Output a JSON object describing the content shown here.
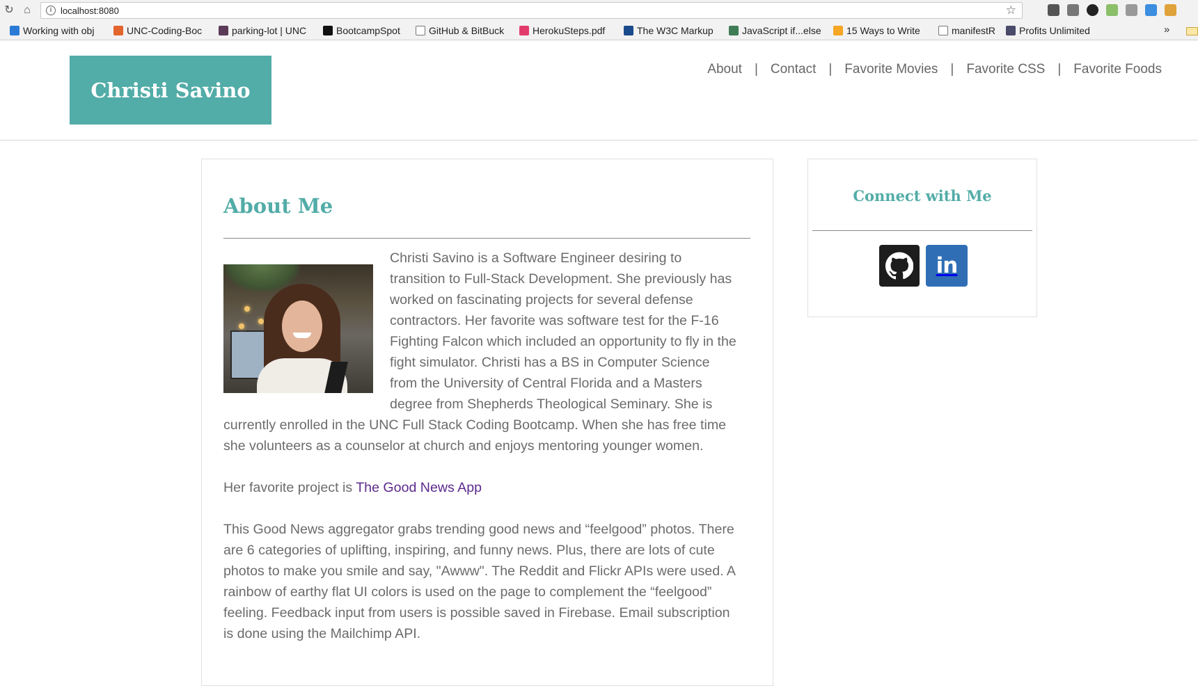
{
  "browser": {
    "url": "localhost:8080",
    "bookmarks": [
      {
        "label": "Working with obj",
        "color": "#2a7bd6"
      },
      {
        "label": "UNC-Coding-Boc",
        "color": "#e2652d"
      },
      {
        "label": "parking-lot | UNC",
        "color": "#5b3a58"
      },
      {
        "label": "BootcampSpot",
        "color": "#111111"
      },
      {
        "label": "GitHub & BitBuck",
        "color": "#ffffff"
      },
      {
        "label": "HerokuSteps.pdf",
        "color": "#e23b6b"
      },
      {
        "label": "The W3C Markup",
        "color": "#1a4b8c"
      },
      {
        "label": "JavaScript if...else",
        "color": "#3f7d57"
      },
      {
        "label": "15 Ways to Write",
        "color": "#f5a623"
      },
      {
        "label": "manifestR",
        "color": "#ffffff"
      },
      {
        "label": "Profits Unlimited",
        "color": "#4a4a6a"
      }
    ],
    "more_label": "»"
  },
  "header": {
    "brand": "Christi Savino",
    "nav": [
      {
        "label": "About"
      },
      {
        "label": "Contact"
      },
      {
        "label": "Favorite Movies"
      },
      {
        "label": "Favorite CSS"
      },
      {
        "label": "Favorite Foods"
      }
    ],
    "separator": "|"
  },
  "about": {
    "title": "About Me",
    "bio": "Christi Savino is a Software Engineer desiring to transition to Full-Stack Development. She previously has worked on fascinating projects for several defense contractors. Her favorite was software test for the F-16 Fighting Falcon which included an opportunity to fly in the fight simulator. Christi has a BS in Computer Science from the University of Central Florida and a Masters degree from Shepherds Theological Seminary. She is currently enrolled in the UNC Full Stack Coding Bootcamp. When she has free time she volunteers as a counselor at church and enjoys mentoring younger women.",
    "favorite_prefix": "Her favorite project is ",
    "favorite_link": "The Good News App",
    "project_description": "This Good News aggregator grabs trending good news and “feelgood” photos. There are 6 categories of uplifting, inspiring, and funny news. Plus, there are lots of cute photos to make you smile and say, \"Awww\". The Reddit and Flickr APIs were used. A rainbow of earthy flat UI colors is used on the page to complement the “feelgood” feeling. Feedback input from users is possible saved in Firebase. Email subscription is done using the Mailchimp API."
  },
  "connect": {
    "title": "Connect with Me",
    "linkedin_label": "in"
  },
  "colors": {
    "accent": "#52aca7",
    "link": "#5c2a8c",
    "github": "#1d1d1d",
    "linkedin": "#2f6eb5"
  }
}
